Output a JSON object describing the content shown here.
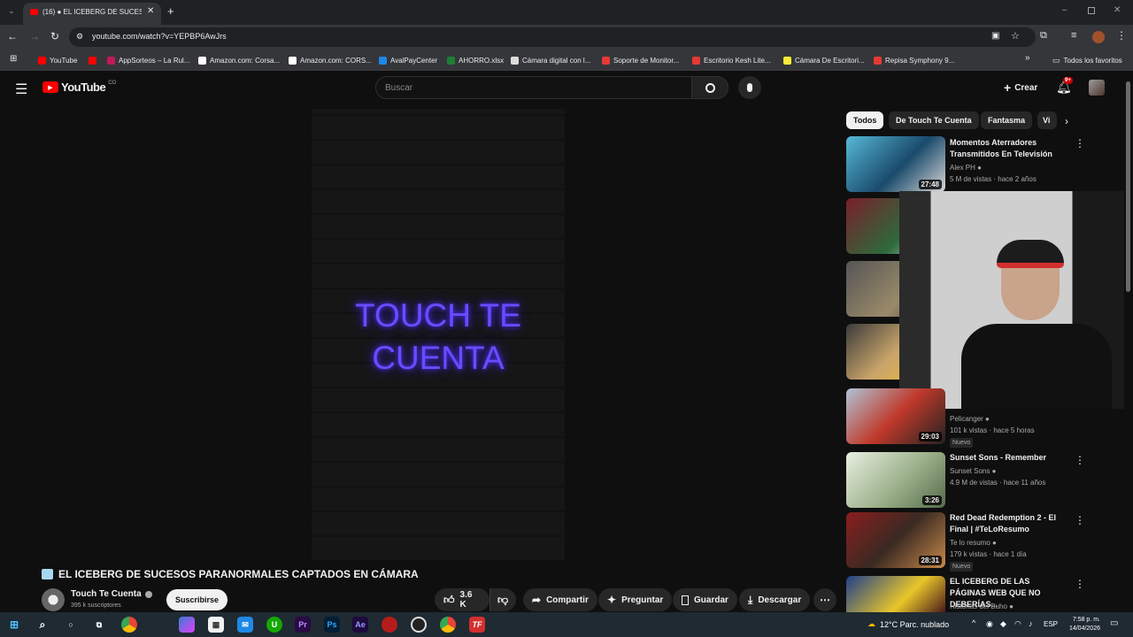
{
  "browser": {
    "tab": {
      "title": "(16) ● EL ICEBERG DE SUCESO"
    },
    "url": "youtube.com/watch?v=YEPBP6AwJrs",
    "bookmarks": [
      "YouTube",
      "",
      "AppSorteos – La Rul...",
      "Amazon.com: Corsa...",
      "Amazon.com: CORS...",
      "AvalPayCenter",
      "AHORRO.xlsx",
      "Cámara digital con l...",
      "Soporte de Monitor...",
      "Escritorio Kesh Lite...",
      "Cámara De Escritori...",
      "Repisa Symphony 9..."
    ],
    "all_favorites": "Todos los favoritos"
  },
  "youtube": {
    "logo": "YouTube",
    "logo_country": "CO",
    "search_placeholder": "Buscar",
    "create_label": "Crear",
    "notif_count": "9+",
    "chips": [
      "Todos",
      "De Touch Te Cuenta",
      "Fantasma",
      "Vi"
    ],
    "video_neon_line1": "TOUCH TE",
    "video_neon_line2": "CUENTA",
    "video_title": "EL ICEBERG DE SUCESOS PARANORMALES CAPTADOS EN CÁMARA",
    "channel_name": "Touch Te Cuenta",
    "subscribers": "395 k suscriptores",
    "subscribe_label": "Suscribirse",
    "like_count": "3.6 K",
    "share_label": "Compartir",
    "ask_label": "Preguntar",
    "save_label": "Guardar",
    "download_label": "Descargar",
    "recommendations": [
      {
        "title": "Momentos Aterradores Transmitidos En Televisión",
        "channel": "Alex PH",
        "meta": "5 M de vistas · hace 2 años",
        "duration": "27:48",
        "new": ""
      },
      {
        "title": "",
        "channel": "Pelicanger",
        "meta": "101 k vistas · hace 5 horas",
        "duration": "29:03",
        "new": "Nuevo"
      },
      {
        "title": "Sunset Sons - Remember",
        "channel": "Sunset Sons",
        "meta": "4.9 M de vistas · hace 11 años",
        "duration": "3:26",
        "new": ""
      },
      {
        "title": "Red Dead Redemption 2 - El Final | #TeLoResumo",
        "channel": "Te lo resumo",
        "meta": "179 k vistas · hace 1 día",
        "duration": "28:31",
        "new": "Nuevo"
      },
      {
        "title": "EL ICEBERG DE LAS PÁGINAS WEB QUE NO DEBERÍAS...",
        "channel": "Historias del Buho",
        "meta": "",
        "duration": "",
        "new": ""
      }
    ]
  },
  "taskbar": {
    "weather": "12°C  Parc. nublado",
    "lang": "ESP",
    "time": "7:58 p. m.",
    "date": "14/04/2026"
  }
}
